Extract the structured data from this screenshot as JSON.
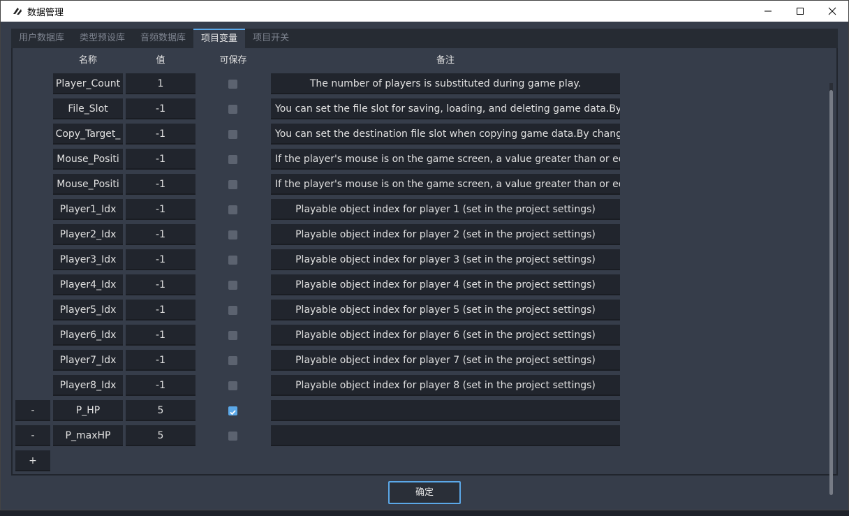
{
  "window": {
    "title": "数据管理"
  },
  "tabs": [
    "用户数据库",
    "类型预设库",
    "音频数据库",
    "项目变量",
    "项目开关"
  ],
  "active_tab": 3,
  "headers": {
    "name": "名称",
    "value": "值",
    "savable": "可保存",
    "note": "备注"
  },
  "rows": [
    {
      "name": "Player_Count",
      "value": "1",
      "savable": false,
      "note": "The number of players is substituted during game play.",
      "center": true,
      "removable": false
    },
    {
      "name": "File_Slot",
      "value": "-1",
      "savable": false,
      "note": "You can set the file slot for saving, loading, and deleting game data.By spe",
      "center": false,
      "removable": false
    },
    {
      "name": "Copy_Target_",
      "value": "-1",
      "savable": false,
      "note": "You can set the destination file slot when copying game data.By changing",
      "center": false,
      "removable": false
    },
    {
      "name": "Mouse_Positi",
      "value": "-1",
      "savable": false,
      "note": "If the player's mouse is on the game screen, a value greater than or equal",
      "center": false,
      "removable": false
    },
    {
      "name": "Mouse_Positi",
      "value": "-1",
      "savable": false,
      "note": "If the player's mouse is on the game screen, a value greater than or equal",
      "center": false,
      "removable": false
    },
    {
      "name": "Player1_Idx",
      "value": "-1",
      "savable": false,
      "note": "Playable object index for player 1 (set in the project settings)",
      "center": true,
      "removable": false
    },
    {
      "name": "Player2_Idx",
      "value": "-1",
      "savable": false,
      "note": "Playable object index for player 2 (set in the project settings)",
      "center": true,
      "removable": false
    },
    {
      "name": "Player3_Idx",
      "value": "-1",
      "savable": false,
      "note": "Playable object index for player 3 (set in the project settings)",
      "center": true,
      "removable": false
    },
    {
      "name": "Player4_Idx",
      "value": "-1",
      "savable": false,
      "note": "Playable object index for player 4 (set in the project settings)",
      "center": true,
      "removable": false
    },
    {
      "name": "Player5_Idx",
      "value": "-1",
      "savable": false,
      "note": "Playable object index for player 5 (set in the project settings)",
      "center": true,
      "removable": false
    },
    {
      "name": "Player6_Idx",
      "value": "-1",
      "savable": false,
      "note": "Playable object index for player 6 (set in the project settings)",
      "center": true,
      "removable": false
    },
    {
      "name": "Player7_Idx",
      "value": "-1",
      "savable": false,
      "note": "Playable object index for player 7 (set in the project settings)",
      "center": true,
      "removable": false
    },
    {
      "name": "Player8_Idx",
      "value": "-1",
      "savable": false,
      "note": "Playable object index for player 8 (set in the project settings)",
      "center": true,
      "removable": false
    },
    {
      "name": "P_HP",
      "value": "5",
      "savable": true,
      "note": "",
      "center": true,
      "removable": true
    },
    {
      "name": "P_maxHP",
      "value": "5",
      "savable": false,
      "note": "",
      "center": true,
      "removable": true
    }
  ],
  "remove_label": "-",
  "add_label": "+",
  "ok_label": "确定",
  "colors": {
    "accent": "#5ba8e8",
    "panel": "#363d4a",
    "cell": "#21252d"
  }
}
